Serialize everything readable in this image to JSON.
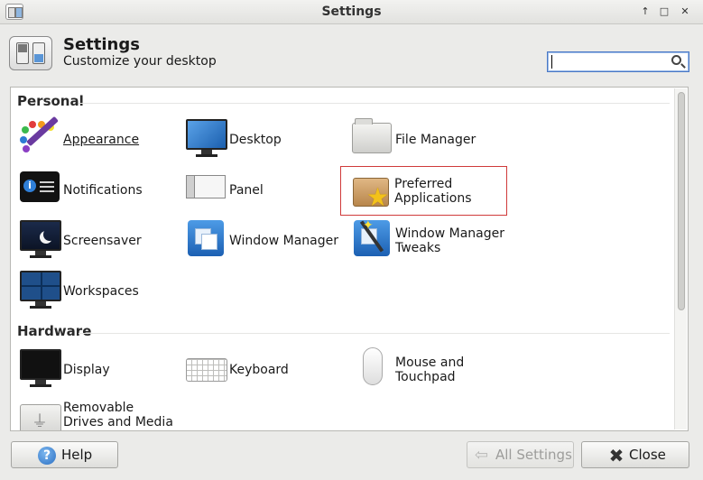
{
  "window": {
    "title": "Settings",
    "controls": [
      "↑",
      "□",
      "✕"
    ]
  },
  "header": {
    "title": "Settings",
    "subtitle": "Customize your desktop",
    "search_placeholder": ""
  },
  "sections": {
    "personal": "Personal",
    "hardware": "Hardware"
  },
  "items": {
    "appearance": "Appearance",
    "desktop": "Desktop",
    "file_manager": "File Manager",
    "notifications": "Notifications",
    "panel": "Panel",
    "preferred_applications": "Preferred\nApplications",
    "screensaver": "Screensaver",
    "window_manager": "Window Manager",
    "window_manager_tweaks": "Window Manager\nTweaks",
    "workspaces": "Workspaces",
    "display": "Display",
    "keyboard": "Keyboard",
    "mouse_touchpad": "Mouse and\nTouchpad",
    "removable_drives": "Removable\nDrives and Media"
  },
  "footer": {
    "help": "Help",
    "all_settings": "All Settings",
    "close": "Close"
  },
  "colors": {
    "selection_border": "#d03a3a",
    "focus_blue": "#4a78c5"
  },
  "icons": {
    "help": "help-icon",
    "back": "back-arrow-icon",
    "close": "close-x-icon"
  }
}
